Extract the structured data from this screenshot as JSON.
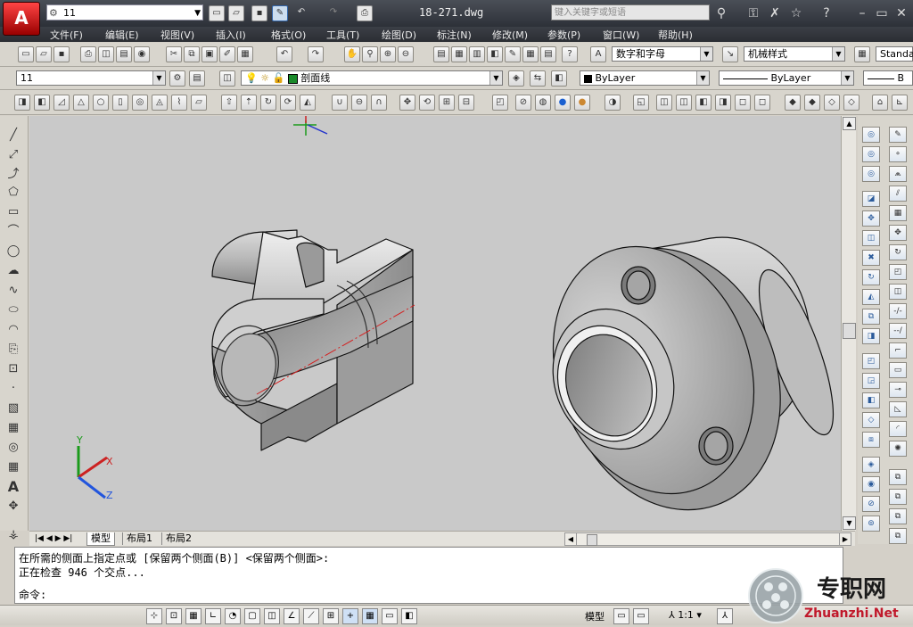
{
  "titlebar": {
    "workspace": "11",
    "document": "18-271.dwg",
    "search_placeholder": "键入关键字或短语",
    "help": "?"
  },
  "menu": [
    "文件(F)",
    "编辑(E)",
    "视图(V)",
    "插入(I)",
    "格式(O)",
    "工具(T)",
    "绘图(D)",
    "标注(N)",
    "修改(M)",
    "参数(P)",
    "窗口(W)",
    "帮助(H)"
  ],
  "toolbar_styles": {
    "text_style": "数字和字母",
    "dim_style": "机械样式",
    "table_style": "Standa"
  },
  "toolbar_layers": {
    "layer_state": "11",
    "current_layer": "剖面线",
    "layer_color": "#1a8a2a",
    "color": "ByLayer",
    "linetype": "ByLayer",
    "lineweight": "B"
  },
  "tabs": [
    "模型",
    "布局1",
    "布局2"
  ],
  "command": {
    "line1": "在所需的侧面上指定点或 [保留两个侧面(B)] <保留两个侧面>:",
    "line2": "正在检查 946 个交点...",
    "prompt": "命令:"
  },
  "status": {
    "model": "模型",
    "scale": "1:1"
  },
  "ucs": {
    "x": "X",
    "y": "Y",
    "z": "Z"
  },
  "watermark": {
    "title": "专职网",
    "url": "Zhuanzhi.Net"
  },
  "app_logo": "A"
}
